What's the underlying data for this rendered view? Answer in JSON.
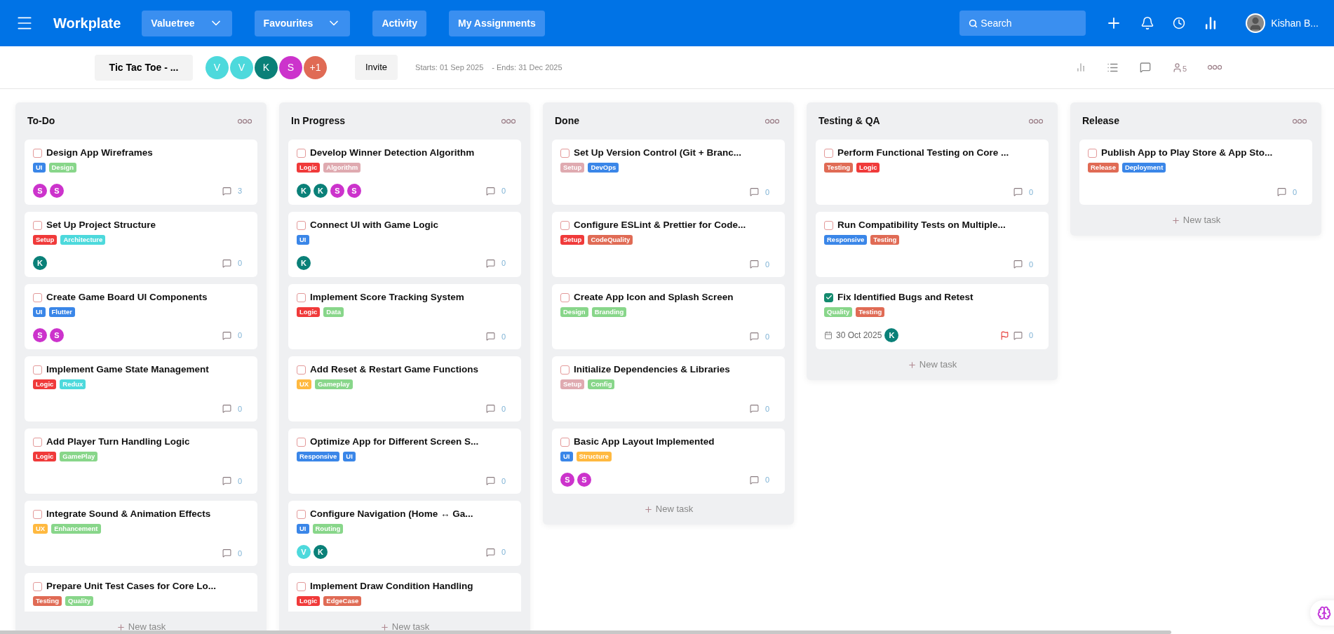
{
  "header": {
    "app_name": "Workplate",
    "nav": [
      {
        "label": "Valuetree",
        "dropdown": true
      },
      {
        "label": "Favourites",
        "dropdown": true
      },
      {
        "label": "Activity",
        "dropdown": false
      },
      {
        "label": "My Assignments",
        "dropdown": false
      }
    ],
    "search": {
      "placeholder": "Search"
    },
    "user": {
      "name": "Kishan B..."
    }
  },
  "project_bar": {
    "project": "Tic Tac Toe - ...",
    "members": [
      {
        "initial": "V",
        "color": "#4dd9dc"
      },
      {
        "initial": "V",
        "color": "#4dd9dc"
      },
      {
        "initial": "K",
        "color": "#0a8078"
      },
      {
        "initial": "S",
        "color": "#cc33cc"
      },
      {
        "initial": "+1",
        "color": "#e06b55"
      }
    ],
    "invite": "Invite",
    "starts": "Starts: 01 Sep 2025",
    "ends": "- Ends: 31 Dec 2025",
    "member_count": "5"
  },
  "columns": [
    {
      "title": "To-Do",
      "new_task": "New task",
      "cards": [
        {
          "title": "Design App Wireframes",
          "done": false,
          "flagged": false,
          "tags": [
            {
              "label": "UI",
              "color": "#3a86e8"
            },
            {
              "label": "Design",
              "color": "#88d68a"
            }
          ],
          "avatars": [
            {
              "initial": "S",
              "color": "#cc33cc"
            },
            {
              "initial": "S",
              "color": "#cc33cc"
            }
          ],
          "comments": "3"
        },
        {
          "title": "Set Up Project Structure",
          "done": false,
          "flagged": false,
          "tags": [
            {
              "label": "Setup",
              "color": "#f03a3a"
            },
            {
              "label": "Architecture",
              "color": "#4dd9dc"
            }
          ],
          "avatars": [
            {
              "initial": "K",
              "color": "#0a8078"
            }
          ],
          "comments": "0"
        },
        {
          "title": "Create Game Board UI Components",
          "done": false,
          "flagged": false,
          "tags": [
            {
              "label": "UI",
              "color": "#3a86e8"
            },
            {
              "label": "Flutter",
              "color": "#3a86e8"
            }
          ],
          "avatars": [
            {
              "initial": "S",
              "color": "#cc33cc"
            },
            {
              "initial": "S",
              "color": "#cc33cc"
            }
          ],
          "comments": "0"
        },
        {
          "title": "Implement Game State Management",
          "done": false,
          "flagged": false,
          "tags": [
            {
              "label": "Logic",
              "color": "#f03a3a"
            },
            {
              "label": "Redux",
              "color": "#4dd9dc"
            }
          ],
          "comments": "0"
        },
        {
          "title": "Add Player Turn Handling Logic",
          "done": false,
          "flagged": false,
          "tags": [
            {
              "label": "Logic",
              "color": "#f03a3a"
            },
            {
              "label": "GamePlay",
              "color": "#88d68a"
            }
          ],
          "comments": "0"
        },
        {
          "title": "Integrate Sound & Animation Effects",
          "done": false,
          "flagged": false,
          "tags": [
            {
              "label": "UX",
              "color": "#ffb940"
            },
            {
              "label": "Enhancement",
              "color": "#88d68a"
            }
          ],
          "comments": "0"
        },
        {
          "title": "Prepare Unit Test Cases for Core Lo...",
          "done": false,
          "tags": [
            {
              "label": "Testing",
              "color": "#e06b55"
            },
            {
              "label": "Quality",
              "color": "#88d68a"
            }
          ]
        }
      ]
    },
    {
      "title": "In Progress",
      "new_task": "New task",
      "cards": [
        {
          "title": "Develop Winner Detection Algorithm",
          "done": false,
          "flagged": false,
          "tags": [
            {
              "label": "Logic",
              "color": "#f03a3a"
            },
            {
              "label": "Algorithm",
              "color": "#dfaab0"
            }
          ],
          "avatars": [
            {
              "initial": "K",
              "color": "#0a8078"
            },
            {
              "initial": "K",
              "color": "#0a8078"
            },
            {
              "initial": "S",
              "color": "#cc33cc"
            },
            {
              "initial": "S",
              "color": "#cc33cc"
            }
          ],
          "comments": "0"
        },
        {
          "title": "Connect UI with Game Logic",
          "done": false,
          "flagged": false,
          "tags": [
            {
              "label": "UI",
              "color": "#3a86e8"
            }
          ],
          "avatars": [
            {
              "initial": "K",
              "color": "#0a8078"
            }
          ],
          "comments": "0"
        },
        {
          "title": "Implement Score Tracking System",
          "done": false,
          "flagged": false,
          "tags": [
            {
              "label": "Logic",
              "color": "#f03a3a"
            },
            {
              "label": "Data",
              "color": "#88d68a"
            }
          ],
          "comments": "0"
        },
        {
          "title": "Add Reset & Restart Game Functions",
          "done": false,
          "flagged": false,
          "tags": [
            {
              "label": "UX",
              "color": "#ffb940"
            },
            {
              "label": "Gameplay",
              "color": "#88d68a"
            }
          ],
          "comments": "0"
        },
        {
          "title": "Optimize App for Different Screen S...",
          "done": false,
          "flagged": false,
          "tags": [
            {
              "label": "Responsive",
              "color": "#3a86e8"
            },
            {
              "label": "UI",
              "color": "#3a86e8"
            }
          ],
          "comments": "0"
        },
        {
          "title": "Configure Navigation (Home ↔ Ga...",
          "done": false,
          "flagged": false,
          "tags": [
            {
              "label": "UI",
              "color": "#3a86e8"
            },
            {
              "label": "Routing",
              "color": "#88d68a"
            }
          ],
          "avatars": [
            {
              "initial": "V",
              "color": "#4dd9dc"
            },
            {
              "initial": "K",
              "color": "#0a8078"
            }
          ],
          "comments": "0"
        },
        {
          "title": "Implement Draw Condition Handling",
          "done": false,
          "tags": [
            {
              "label": "Logic",
              "color": "#f03a3a"
            },
            {
              "label": "EdgeCase",
              "color": "#e06b55"
            }
          ]
        }
      ]
    },
    {
      "title": "Done",
      "new_task": "New task",
      "cards": [
        {
          "title": "Set Up Version Control (Git + Branc...",
          "done": false,
          "flagged": false,
          "tags": [
            {
              "label": "Setup",
              "color": "#dfaab0"
            },
            {
              "label": "DevOps",
              "color": "#3a86e8"
            }
          ],
          "comments": "0"
        },
        {
          "title": "Configure ESLint & Prettier for Code...",
          "done": false,
          "flagged": false,
          "tags": [
            {
              "label": "Setup",
              "color": "#f03a3a"
            },
            {
              "label": "CodeQuality",
              "color": "#e06b55"
            }
          ],
          "comments": "0"
        },
        {
          "title": "Create App Icon and Splash Screen",
          "done": false,
          "flagged": false,
          "tags": [
            {
              "label": "Design",
              "color": "#88d68a"
            },
            {
              "label": "Branding",
              "color": "#88d68a"
            }
          ],
          "comments": "0"
        },
        {
          "title": "Initialize Dependencies & Libraries",
          "done": false,
          "flagged": false,
          "tags": [
            {
              "label": "Setup",
              "color": "#dfaab0"
            },
            {
              "label": "Config",
              "color": "#88d68a"
            }
          ],
          "comments": "0"
        },
        {
          "title": "Basic App Layout Implemented",
          "done": false,
          "flagged": false,
          "tags": [
            {
              "label": "UI",
              "color": "#3a86e8"
            },
            {
              "label": "Structure",
              "color": "#ffb940"
            }
          ],
          "avatars": [
            {
              "initial": "S",
              "color": "#cc33cc"
            },
            {
              "initial": "S",
              "color": "#cc33cc"
            }
          ],
          "comments": "0"
        }
      ]
    },
    {
      "title": "Testing & QA",
      "new_task": "New task",
      "cards": [
        {
          "title": "Perform Functional Testing on Core ...",
          "done": false,
          "flagged": false,
          "tags": [
            {
              "label": "Testing",
              "color": "#e06b55"
            },
            {
              "label": "Logic",
              "color": "#f03a3a"
            }
          ],
          "comments": "0"
        },
        {
          "title": "Run Compatibility Tests on Multiple...",
          "done": false,
          "flagged": false,
          "tags": [
            {
              "label": "Responsive",
              "color": "#3a86e8"
            },
            {
              "label": "Testing",
              "color": "#e06b55"
            }
          ],
          "comments": "0"
        },
        {
          "title": "Fix Identified Bugs and Retest",
          "done": true,
          "flagged": true,
          "due": "30 Oct 2025",
          "tags": [
            {
              "label": "Quality",
              "color": "#88d68a"
            },
            {
              "label": "Testing",
              "color": "#e06b55"
            }
          ],
          "avatars": [
            {
              "initial": "K",
              "color": "#0a8078"
            }
          ],
          "comments": "0"
        }
      ]
    },
    {
      "title": "Release",
      "new_task": "New task",
      "cards": [
        {
          "title": "Publish App to Play Store & App Sto...",
          "done": false,
          "flagged": false,
          "tags": [
            {
              "label": "Release",
              "color": "#e06b55"
            },
            {
              "label": "Deployment",
              "color": "#3a86e8"
            }
          ],
          "comments": "0"
        }
      ]
    }
  ]
}
